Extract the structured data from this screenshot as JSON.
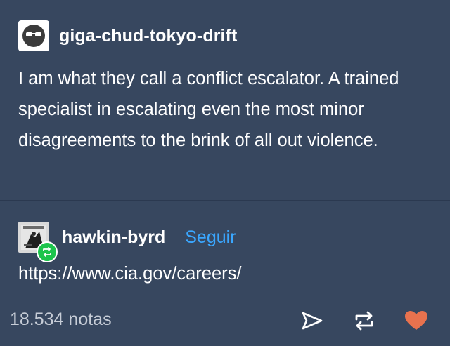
{
  "post": {
    "author": "giga-chud-tokyo-drift",
    "text": "I am what they call a conflict escalator. A trained specialist in escalating even the most minor disagreements to the brink of all out violence."
  },
  "reblog": {
    "author": "hawkin-byrd",
    "follow_label": "Seguir",
    "text": "https://www.cia.gov/careers/"
  },
  "footer": {
    "notes_count": "18.534 notas",
    "icons": [
      "send-icon",
      "reblog-icon",
      "heart-icon"
    ],
    "heart_color": "#e8724e"
  },
  "colors": {
    "background": "#37475f",
    "link_accent": "#3aa7ff",
    "reblog_badge": "#1cc44c"
  }
}
